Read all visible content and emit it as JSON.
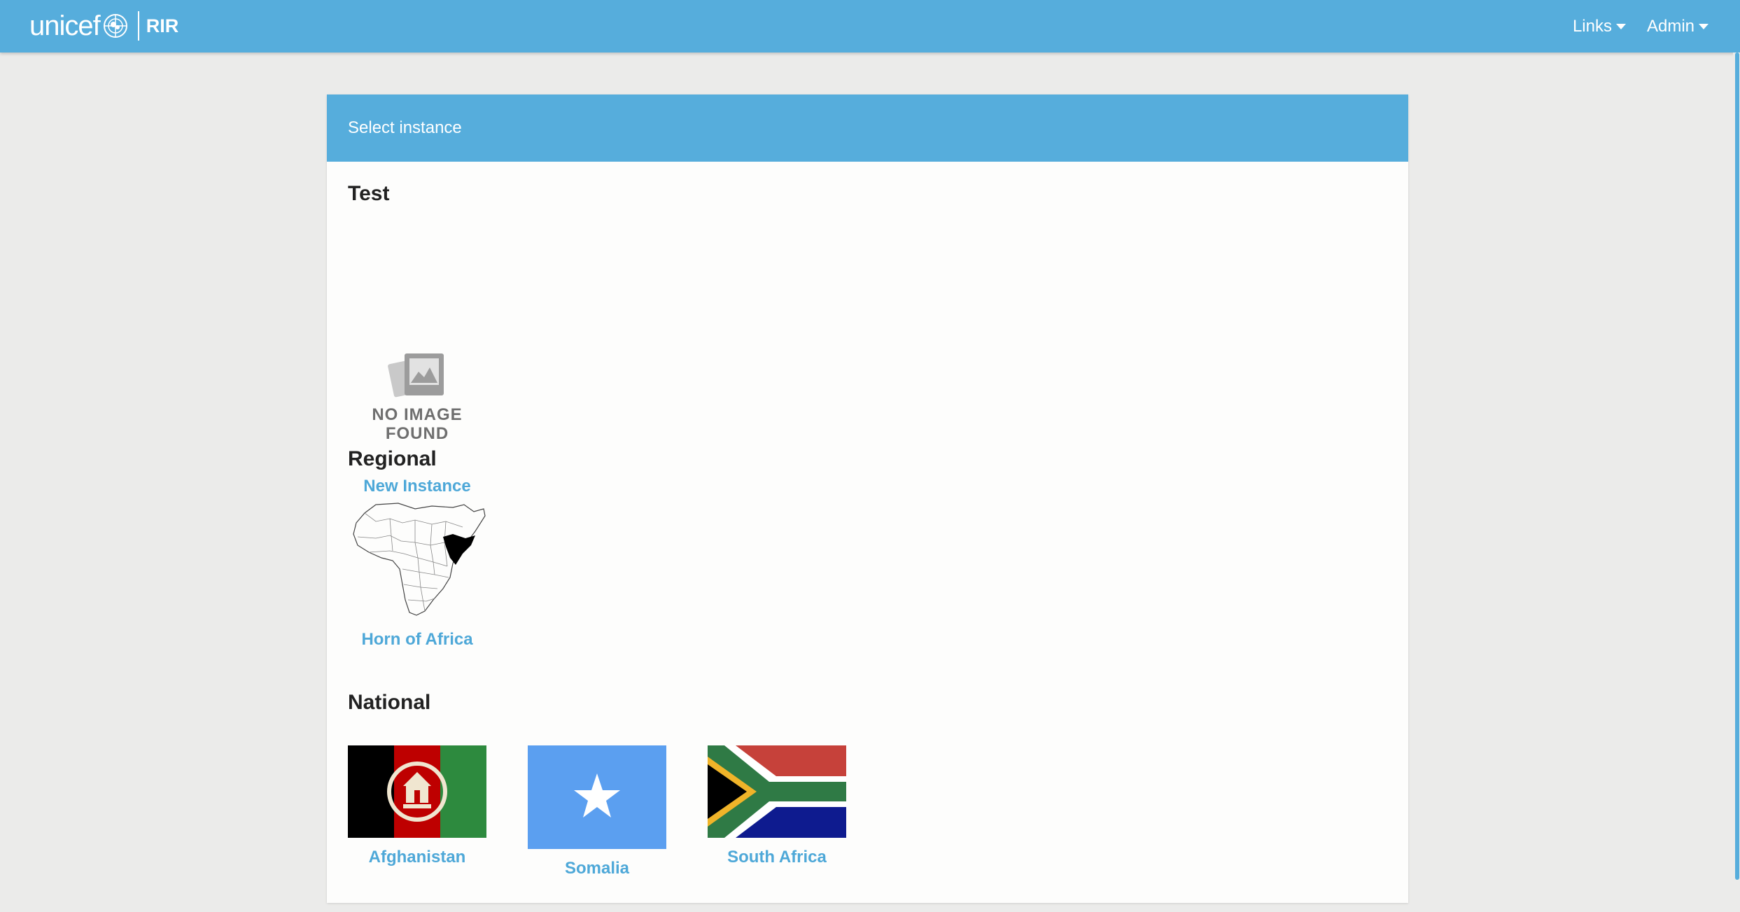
{
  "header": {
    "brand": "unicef",
    "app_name": "RIR",
    "menus": [
      {
        "label": "Links"
      },
      {
        "label": "Admin"
      }
    ]
  },
  "panel": {
    "title": "Select instance",
    "sections": [
      {
        "title": "Test",
        "items": [
          {
            "label": "New Instance",
            "image_text": "NO IMAGE FOUND",
            "icon": "no-image-icon"
          }
        ]
      },
      {
        "title": "Regional",
        "items": [
          {
            "label": "Horn of Africa",
            "icon": "africa-map"
          }
        ]
      },
      {
        "title": "National",
        "items": [
          {
            "label": "Afghanistan",
            "icon": "afghanistan-flag"
          },
          {
            "label": "Somalia",
            "icon": "somalia-flag"
          },
          {
            "label": "South Africa",
            "icon": "south-africa-flag"
          }
        ]
      }
    ]
  },
  "colors": {
    "primary": "#56addc",
    "link": "#4ea8d8",
    "background": "#ebebea",
    "card": "#fdfdfc"
  }
}
